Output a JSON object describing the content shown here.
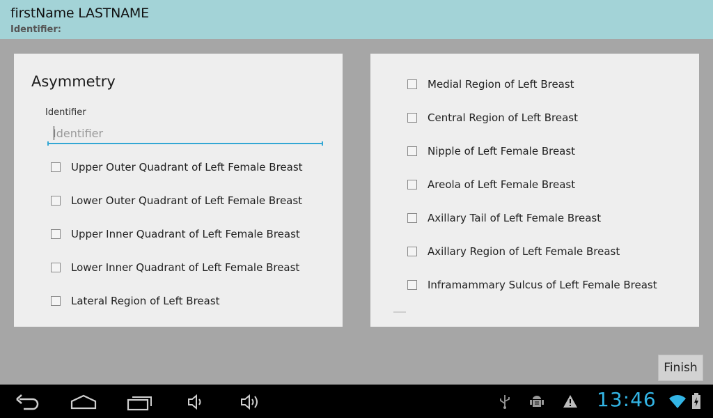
{
  "header": {
    "patient_name": "firstName LASTNAME",
    "identifier_label": "Identifier:"
  },
  "left_panel": {
    "title": "Asymmetry",
    "identifier_field": {
      "label": "Identifier",
      "placeholder": "Identifier",
      "value": ""
    },
    "options": [
      {
        "label": "Upper Outer Quadrant of Left Female Breast",
        "checked": false
      },
      {
        "label": "Lower Outer Quadrant of Left Female Breast",
        "checked": false
      },
      {
        "label": "Upper Inner Quadrant of Left Female Breast",
        "checked": false
      },
      {
        "label": "Lower Inner Quadrant of Left Female Breast",
        "checked": false
      },
      {
        "label": "Lateral Region of Left Breast",
        "checked": false
      }
    ]
  },
  "right_panel": {
    "options": [
      {
        "label": "Medial Region of Left Breast",
        "checked": false
      },
      {
        "label": "Central Region of Left Breast",
        "checked": false
      },
      {
        "label": "Nipple of Left Female Breast",
        "checked": false
      },
      {
        "label": "Areola of Left Female Breast",
        "checked": false
      },
      {
        "label": "Axillary Tail of Left Female Breast",
        "checked": false
      },
      {
        "label": "Axillary Region of Left Female Breast",
        "checked": false
      },
      {
        "label": "Inframammary Sulcus of Left Female Breast",
        "checked": false
      }
    ]
  },
  "actions": {
    "finish_label": "Finish"
  },
  "system_bar": {
    "clock": "13:46",
    "nav_icons": [
      "back-icon",
      "home-icon",
      "recent-apps-icon",
      "volume-down-icon",
      "volume-up-icon"
    ],
    "status_icons": [
      "usb-icon",
      "android-debug-icon",
      "warning-icon",
      "wifi-icon",
      "battery-charging-icon"
    ],
    "accent_color": "#33b5e5"
  },
  "colors": {
    "header_bg": "#a3d3d7",
    "background": "#a6a6a6",
    "panel_bg": "#eeeeee",
    "input_underline": "#33a7d4"
  }
}
